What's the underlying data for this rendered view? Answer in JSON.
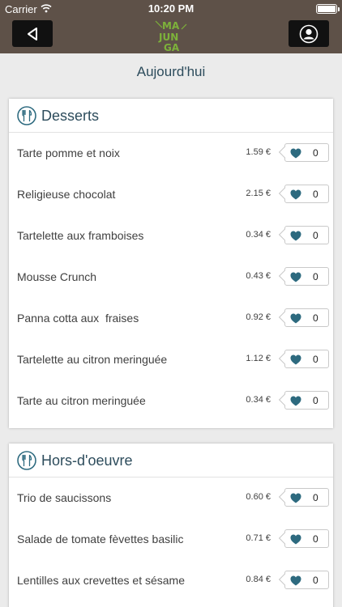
{
  "status": {
    "carrier": "Carrier",
    "time": "10:20 PM"
  },
  "logo_text": [
    "MA",
    "JUN",
    "GA"
  ],
  "page_title": "Aujourd'hui",
  "colors": {
    "accent": "#2d6a7f",
    "topbar": "#5e5148",
    "logo": "#7db23a"
  },
  "sections": [
    {
      "title": "Desserts",
      "items": [
        {
          "name": "Tarte pomme et noix",
          "price": "1.59 €",
          "likes": "0"
        },
        {
          "name": "Religieuse chocolat",
          "price": "2.15 €",
          "likes": "0"
        },
        {
          "name": "Tartelette aux framboises",
          "price": "0.34 €",
          "likes": "0"
        },
        {
          "name": "Mousse Crunch",
          "price": "0.43 €",
          "likes": "0"
        },
        {
          "name": "Panna cotta aux  fraises",
          "price": "0.92 €",
          "likes": "0"
        },
        {
          "name": "Tartelette au citron meringuée",
          "price": "1.12 €",
          "likes": "0"
        },
        {
          "name": "Tarte au citron meringuée",
          "price": "0.34 €",
          "likes": "0"
        }
      ]
    },
    {
      "title": "Hors-d'oeuvre",
      "items": [
        {
          "name": "Trio de saucissons",
          "price": "0.60 €",
          "likes": "0"
        },
        {
          "name": "Salade de tomate fèvettes basilic",
          "price": "0.71 €",
          "likes": "0"
        },
        {
          "name": "Lentilles aux crevettes et sésame",
          "price": "0.84 €",
          "likes": "0"
        }
      ]
    }
  ]
}
